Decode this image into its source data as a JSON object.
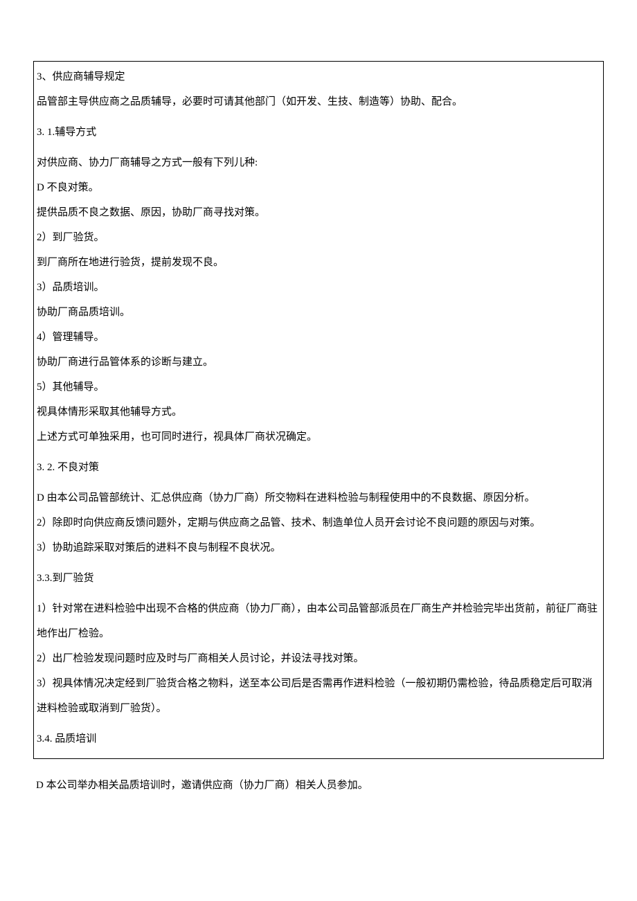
{
  "box": {
    "l1": "3、供应商辅导规定",
    "l2": "品管部主导供应商之品质辅导，必要时可请其他部门（如开发、生技、制造等）协助、配合。",
    "l3": "3.  1.辅导方式",
    "l4": "对供应商、协力厂商辅导之方式一般有下列儿种:",
    "l5": "D 不良对策。",
    "l6": "提供品质不良之数据、原因，协助厂商寻找对策。",
    "l7": "2）到厂验货。",
    "l8": "到厂商所在地进行验货，提前发现不良。",
    "l9": "3）品质培训。",
    "l10": "协助厂商品质培训。",
    "l11": "4）管理辅导。",
    "l12": "协助厂商进行品管体系的诊断与建立。",
    "l13": "5）其他辅导。",
    "l14": "视具体情形采取其他辅导方式。",
    "l15": "上述方式可单独采用，也可同时进行，视具体厂商状况确定。",
    "l16": "3.  2. 不良对策",
    "l17": "D 由本公司品管部统计、汇总供应商（协力厂商）所交物料在进料检验与制程使用中的不良数据、原因分析。",
    "l18": "2）除即时向供应商反馈问题外，定期与供应商之品管、技术、制造单位人员开会讨论不良问题的原因与对策。",
    "l19": "3）协助追踪采取对策后的进料不良与制程不良状况。",
    "l20": "3.3.到厂验货",
    "l21": "1）针对常在进料检验中出现不合格的供应商（协力厂商），由本公司品管部派员在厂商生产并检验完毕出货前，前征厂商驻地作出厂检验。",
    "l22": "2）出厂检验发现问题时应及时与厂商相关人员讨论，并设法寻找对策。",
    "l23": "3）视具体情况决定经到厂验货合格之物料，送至本公司后是否需再作进料检验（一般初期仍需检验，待品质稳定后可取消进料检验或取消到厂验货）。",
    "l24": "3.4. 品质培训"
  },
  "outside": {
    "l1": "D 本公司举办相关品质培训时，邀请供应商（协力厂商）相关人员参加。"
  }
}
